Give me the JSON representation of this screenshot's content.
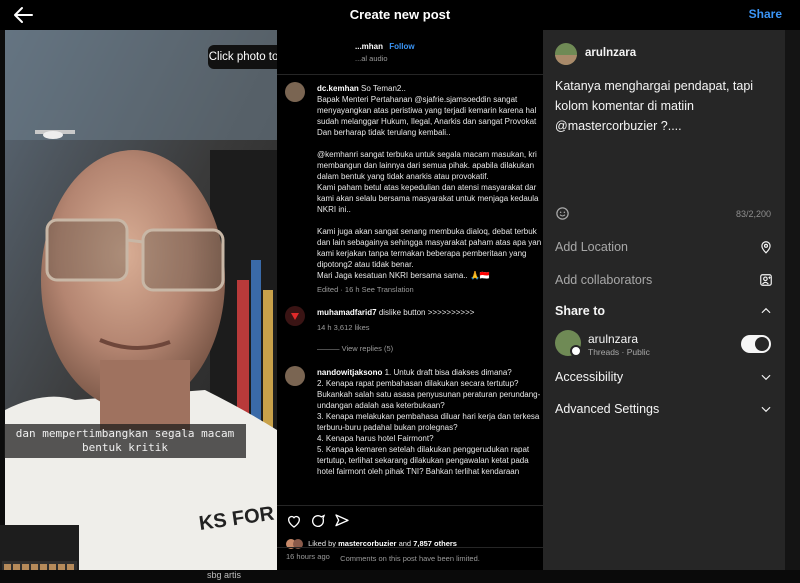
{
  "header": {
    "title": "Create new post",
    "share_label": "Share"
  },
  "photo": {
    "tag_tooltip": "Click photo to tag people",
    "caption_line1": "dan mempertimbangkan segala macam",
    "caption_line2": "bentuk kritik"
  },
  "post": {
    "owner": "...mhan",
    "follow": "Follow",
    "audio": "...al audio",
    "comments": [
      {
        "user": "dc.kemhan",
        "lead": "So Teman2..",
        "lines": [
          "Bapak Menteri Pertahanan @sjafrie.sjamsoeddin sangat",
          "menyayangkan atas peristiwa yang terjadi kemarin karena hal",
          "sudah melanggar Hukum, Ilegal, Anarkis dan sangat Provokat",
          "Dan berharap tidak terulang kembali..",
          "",
          "@kemhanri sangat terbuka untuk segala macam masukan, kri",
          "membangun dan lainnya dari semua pihak. apabila dilakukan",
          "dalam bentuk yang tidak anarkis atau provokatif.",
          "Kami paham betul atas kepedulian dan atensi masyarakat dar",
          "kami akan selalu bersama masyarakat untuk menjaga kedaula",
          "NKRI ini..",
          "",
          "Kami juga akan sangat senang membuka dialoq, debat terbuk",
          "dan lain sebagainya sehingga masyarakat paham atas apa yan",
          "kami kerjakan tanpa termakan beberapa pemberitaan yang",
          "dipotong2 atau tidak benar.",
          "Mari Jaga kesatuan NKRI bersama sama.. 🙏🇮🇩"
        ],
        "meta": "Edited · 16 h     See Translation"
      },
      {
        "user": "muhamadfarid7",
        "lead": "dislike button >>>>>>>>>>",
        "meta": "14 h     3,612 likes",
        "replies": "View replies (5)"
      },
      {
        "user": "nandowitjaksono",
        "lead": "1. Untuk draft bisa diakses dimana?",
        "lines": [
          "2. Kenapa rapat pembahasan dilakukan secara tertutup?",
          "Bukankah salah satu asasa penyusunan peraturan perundang-",
          "undangan adalah asa keterbukaan?",
          "3. Kenapa melakukan pembahasa diluar hari kerja dan terkesa",
          "terburu-buru padahal bukan prolegnas?",
          "4. Kenapa harus hotel Fairmont?",
          "5. Kenapa kemaren setelah dilakukan penggerudukan rapat",
          "tertutup, terlihat sekarang dilakukan pengawalan ketat pada",
          "hotel fairmont oleh pihak TNI? Bahkan terlihat kendaraan"
        ]
      }
    ],
    "liked_by_prefix": "Liked by",
    "liked_by_user": "mastercorbuzier",
    "liked_by_and": "and",
    "liked_by_count": "7,857 others",
    "time_ago": "16 hours ago",
    "limited_notice": "Comments on this post have been limited."
  },
  "panel": {
    "username": "arulnzara",
    "caption_text": "Katanya menghargai pendapat, tapi kolom komentar di matiin @mastercorbuzier ?....",
    "char_count": "83/2,200",
    "add_location": "Add Location",
    "add_collaborators": "Add collaborators",
    "share_to": "Share to",
    "account_name": "arulnzara",
    "account_sub": "Threads · Public",
    "threads_toggle_on": true,
    "accessibility": "Accessibility",
    "advanced_settings": "Advanced Settings"
  },
  "footer": {
    "label": "sbg artis"
  },
  "colors": {
    "accent": "#3b95f6",
    "panel": "#262626",
    "background": "#000000"
  }
}
